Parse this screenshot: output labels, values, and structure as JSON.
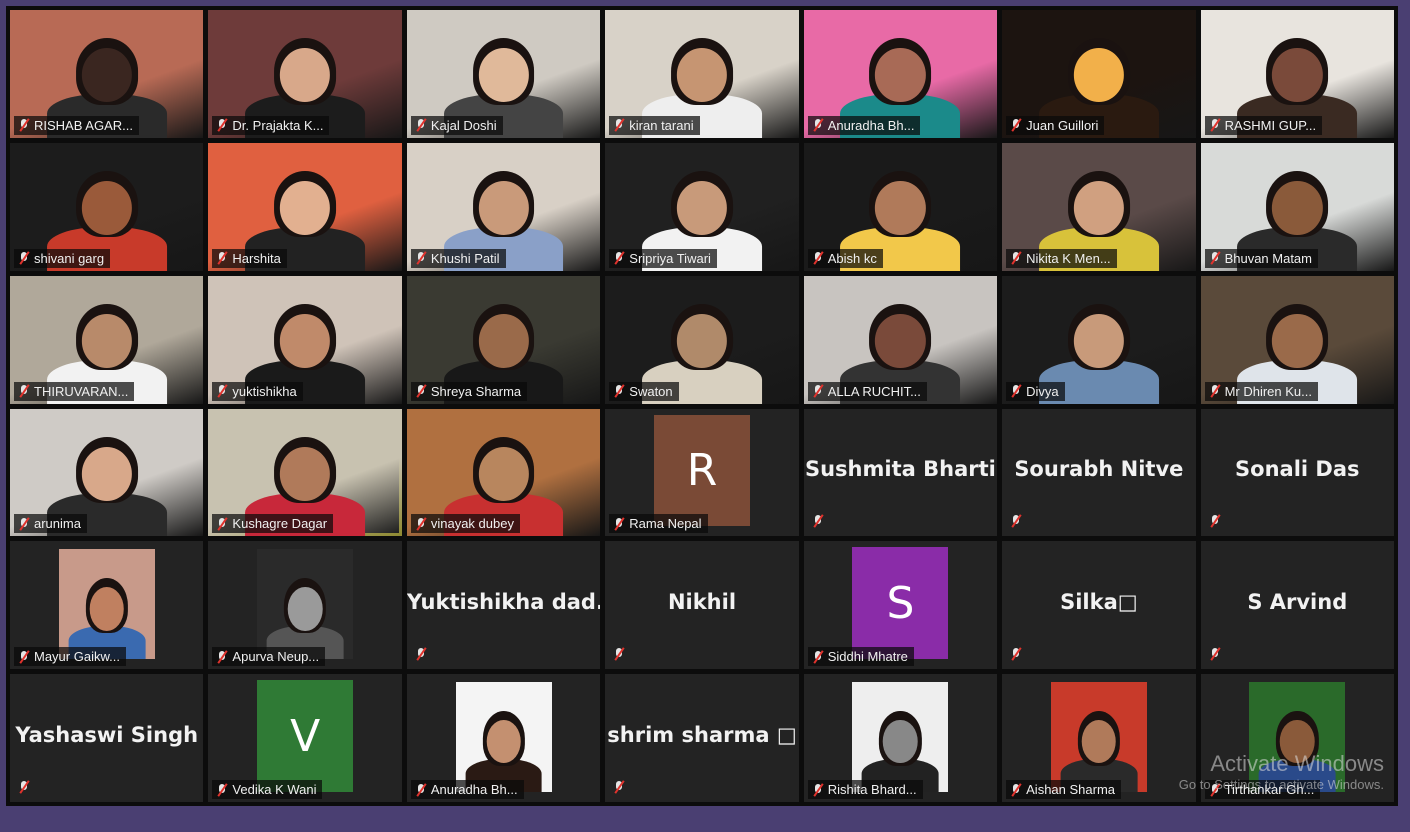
{
  "watermark": {
    "title": "Activate Windows",
    "subtitle": "Go to Settings to activate Windows."
  },
  "participants": [
    {
      "name": "RISHAB AGAR...",
      "kind": "video"
    },
    {
      "name": "Dr. Prajakta K...",
      "kind": "video"
    },
    {
      "name": "Kajal Doshi",
      "kind": "video"
    },
    {
      "name": "kiran tarani",
      "kind": "video"
    },
    {
      "name": "Anuradha Bh...",
      "kind": "video"
    },
    {
      "name": "Juan Guillori",
      "kind": "video"
    },
    {
      "name": "RASHMI GUP...",
      "kind": "video"
    },
    {
      "name": "shivani garg",
      "kind": "video"
    },
    {
      "name": "Harshita",
      "kind": "video"
    },
    {
      "name": "Khushi Patil",
      "kind": "video"
    },
    {
      "name": "Sripriya Tiwari",
      "kind": "video"
    },
    {
      "name": "Abish kc",
      "kind": "video"
    },
    {
      "name": "Nikita K Men...",
      "kind": "video"
    },
    {
      "name": "Bhuvan Matam",
      "kind": "video"
    },
    {
      "name": "THIRUVARAN...",
      "kind": "video"
    },
    {
      "name": "yuktishikha",
      "kind": "video"
    },
    {
      "name": "Shreya Sharma",
      "kind": "video"
    },
    {
      "name": "Swaton",
      "kind": "video"
    },
    {
      "name": "ALLA RUCHIT...",
      "kind": "video"
    },
    {
      "name": "Divya",
      "kind": "video"
    },
    {
      "name": "Mr Dhiren Ku...",
      "kind": "video"
    },
    {
      "name": "arunima",
      "kind": "video"
    },
    {
      "name": "Kushagre Dagar",
      "kind": "video"
    },
    {
      "name": "vinayak dubey",
      "kind": "video"
    },
    {
      "name": "Rama Nepal",
      "kind": "letter",
      "letter": "R",
      "color": "#7a4a36"
    },
    {
      "name": "Sushmita Bharti",
      "kind": "text"
    },
    {
      "name": "Sourabh Nitve",
      "kind": "text"
    },
    {
      "name": "Sonali Das",
      "kind": "text"
    },
    {
      "name": "Mayur Gaikw...",
      "kind": "photo"
    },
    {
      "name": "Apurva Neup...",
      "kind": "photo"
    },
    {
      "name": "Yuktishikha dad...",
      "kind": "text"
    },
    {
      "name": "Nikhil",
      "kind": "text"
    },
    {
      "name": "Siddhi Mhatre",
      "kind": "letter",
      "letter": "S",
      "color": "#8a2ca8"
    },
    {
      "name": "Silka□",
      "kind": "text"
    },
    {
      "name": "S Arvind",
      "kind": "text"
    },
    {
      "name": "Yashaswi Singh",
      "kind": "text"
    },
    {
      "name": "Vedika K Wani",
      "kind": "letter",
      "letter": "V",
      "color": "#2f7a35"
    },
    {
      "name": "Anuradha Bh...",
      "kind": "photo"
    },
    {
      "name": "shrim  sharma □",
      "kind": "text"
    },
    {
      "name": "Rishita Bhard...",
      "kind": "photo"
    },
    {
      "name": "Aishan Sharma",
      "kind": "photo"
    },
    {
      "name": "Tirthankar Gh...",
      "kind": "photo"
    }
  ]
}
